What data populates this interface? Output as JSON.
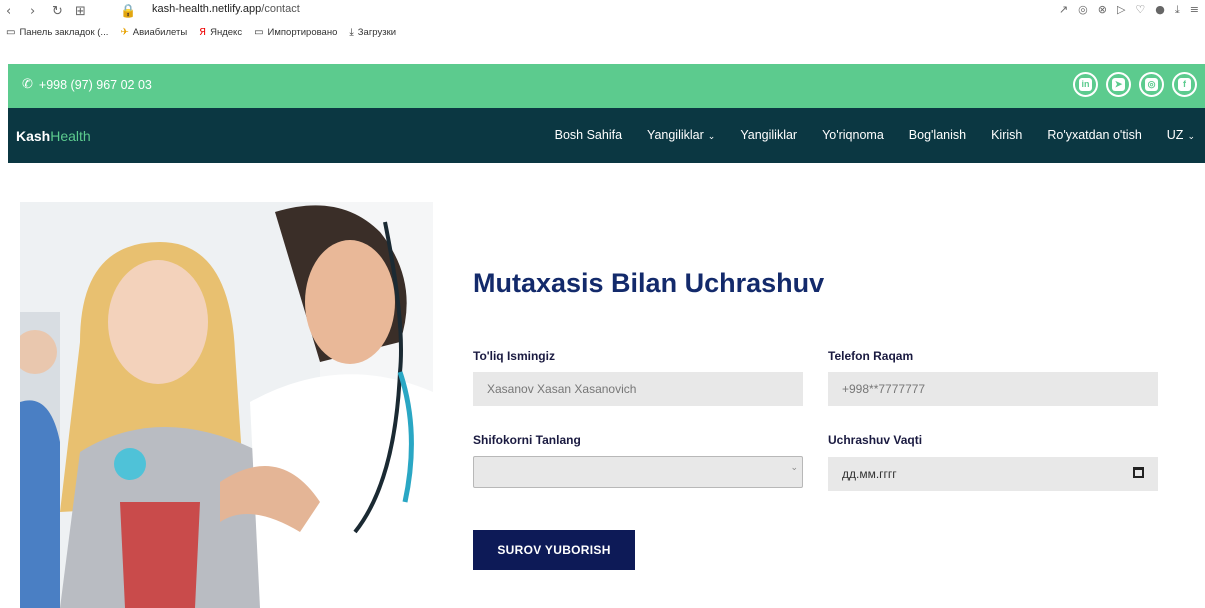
{
  "browser": {
    "url_host": "kash-health.netlify.app",
    "url_path": "/contact",
    "bookmarks": [
      "Панель закладок (...",
      "Авиабилеты",
      "Яндекс",
      "Импортировано",
      "Загрузки"
    ]
  },
  "topbar": {
    "phone": "+998 (97) 967 02 03",
    "socials": [
      "linkedin-icon",
      "telegram-icon",
      "instagram-icon",
      "facebook-icon"
    ]
  },
  "nav": {
    "brand_main": "Kash",
    "brand_accent": "Health",
    "items": [
      "Bosh Sahifa",
      "Yangiliklar",
      "Yangiliklar",
      "Yo'riqnoma",
      "Bog'lanish",
      "Kirish",
      "Ro'yxatdan o'tish",
      "UZ"
    ]
  },
  "form": {
    "title": "Mutaxasis Bilan Uchrashuv",
    "name_label": "To'liq Ismingiz",
    "name_placeholder": "Xasanov Xasan Xasanovich",
    "phone_label": "Telefon Raqam",
    "phone_placeholder": "+998**7777777",
    "doctor_label": "Shifokorni Tanlang",
    "doctor_value": "",
    "time_label": "Uchrashuv Vaqti",
    "time_placeholder": "дд.мм.гггг",
    "submit": "SUROV YUBORISH"
  },
  "colors": {
    "green": "#5ccb8e",
    "navy": "#0b3742",
    "title_blue": "#132a6b",
    "button": "#0d1a57"
  }
}
